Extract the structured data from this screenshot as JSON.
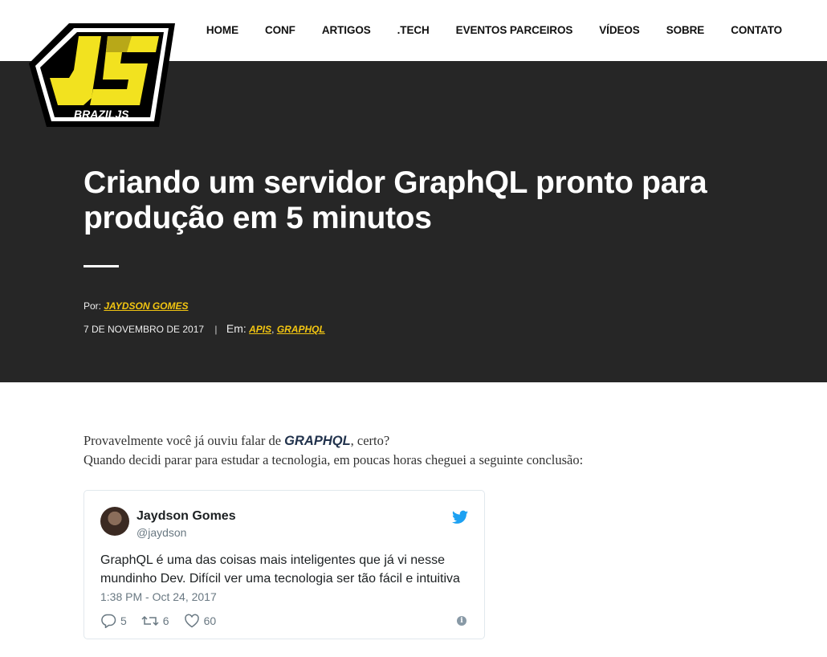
{
  "brand": {
    "logo_text": "BRAZILJS",
    "accent": "#f2c511",
    "hero_bg": "#262626"
  },
  "nav": {
    "items": [
      {
        "label": "HOME"
      },
      {
        "label": "CONF"
      },
      {
        "label": "ARTIGOS"
      },
      {
        "label": ".TECH"
      },
      {
        "label": "EVENTOS PARCEIROS"
      },
      {
        "label": "VÍDEOS"
      },
      {
        "label": "SOBRE"
      },
      {
        "label": "CONTATO"
      }
    ]
  },
  "article": {
    "title": "Criando um servidor GraphQL pronto para produção em 5 minutos",
    "author_prefix": "Por:",
    "author": "JAYDSON GOMES",
    "date": "7 DE NOVEMBRO DE 2017",
    "separator": "|",
    "categories_prefix": "Em:",
    "category_1": "APIS",
    "category_sep": ",",
    "category_2": "GRAPHQL",
    "para1_before": "Provavelmente você já ouviu falar de ",
    "para1_highlight": "GRAPHQL",
    "para1_after": ", certo?",
    "para2": "Quando decidi parar para estudar a tecnologia, em poucas horas cheguei a seguinte conclusão:"
  },
  "tweet": {
    "name": "Jaydson Gomes",
    "handle": "@jaydson",
    "text": "GraphQL é uma das coisas mais inteligentes que já vi nesse mundinho Dev. Difícil ver uma tecnologia ser tão fácil e intuitiva",
    "time": "1:38 PM - Oct 24, 2017",
    "replies": "5",
    "retweets": "6",
    "likes": "60",
    "twitter_blue": "#1da1f2"
  }
}
